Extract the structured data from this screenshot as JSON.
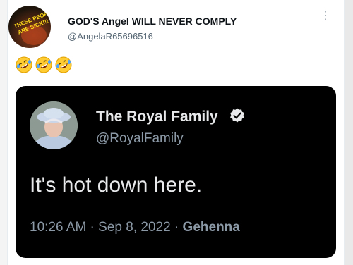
{
  "tweet": {
    "author_name": "GOD'S Angel WILL NEVER COMPLY",
    "author_handle": "@AngelaR65696516",
    "avatar_icon": "text-avatar-icon",
    "avatar_text": "THESE PEOPLE ARE SICK!!!",
    "more_icon": "vertical-ellipsis-icon",
    "more_label": "⋮",
    "emojis": [
      "rolling-on-floor-laughing-emoji",
      "rolling-on-floor-laughing-emoji",
      "rolling-on-floor-laughing-emoji"
    ]
  },
  "quoted": {
    "name": "The Royal Family",
    "verified_icon": "verified-badge-icon",
    "handle": "@RoyalFamily",
    "text": "It's hot down here.",
    "time": "10:26 AM",
    "sep1": " · ",
    "date": "Sep 8, 2022",
    "sep2": " · ",
    "place": "Gehenna"
  },
  "colors": {
    "embed_background": "#000000",
    "primary_text_dark": "#e7e9ea",
    "secondary_text_dark": "#8b98a5",
    "name_text": "#0f1419",
    "handle_text": "#536471"
  }
}
